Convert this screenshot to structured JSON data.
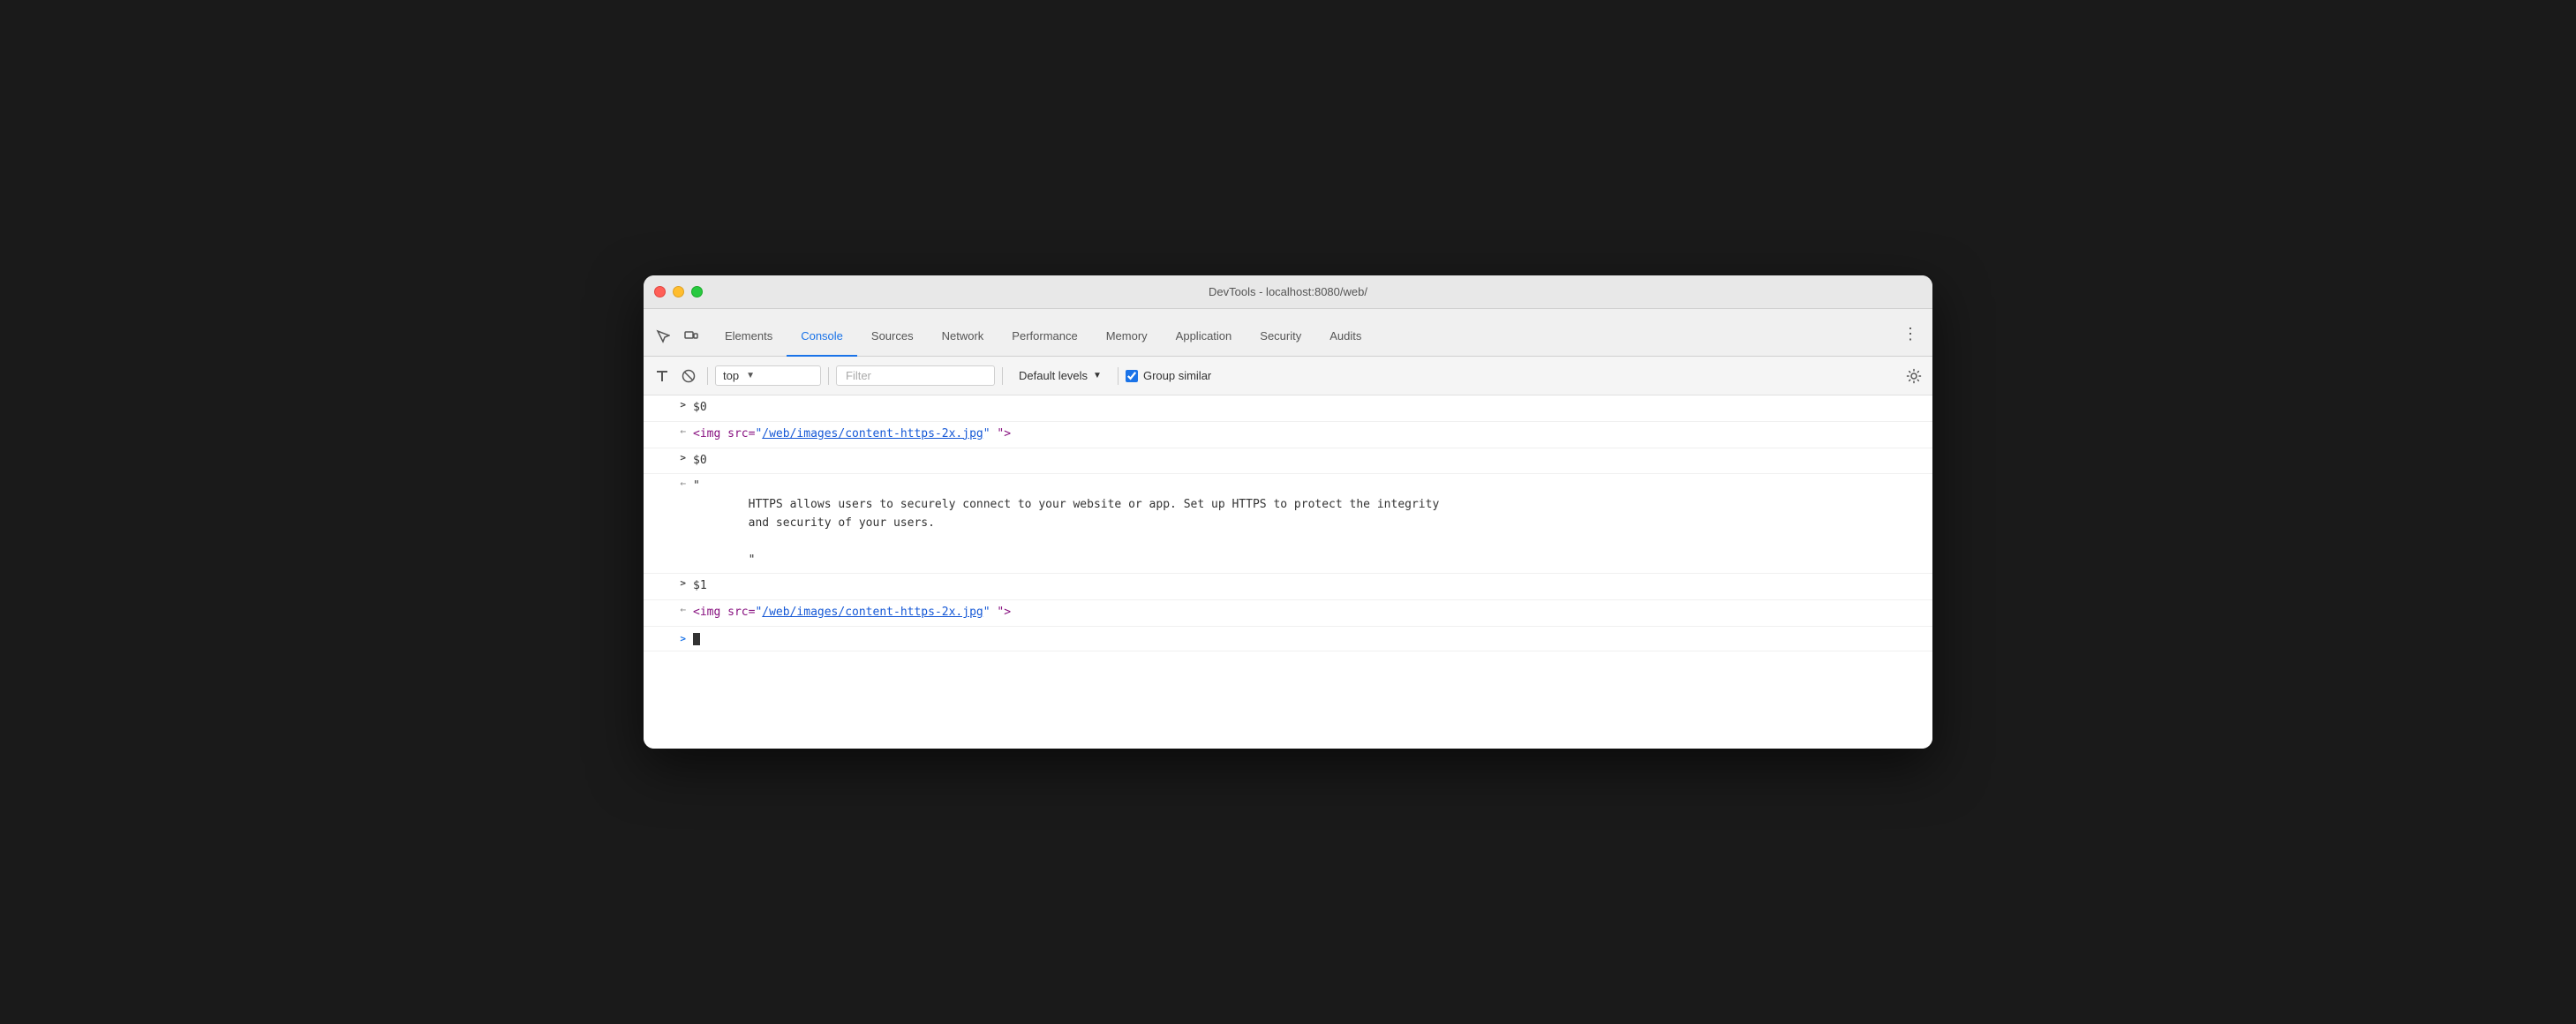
{
  "window": {
    "title": "DevTools - localhost:8080/web/",
    "traffic_lights": {
      "close": "close",
      "minimize": "minimize",
      "maximize": "maximize"
    }
  },
  "tabs": {
    "items": [
      {
        "id": "elements",
        "label": "Elements",
        "active": false
      },
      {
        "id": "console",
        "label": "Console",
        "active": true
      },
      {
        "id": "sources",
        "label": "Sources",
        "active": false
      },
      {
        "id": "network",
        "label": "Network",
        "active": false
      },
      {
        "id": "performance",
        "label": "Performance",
        "active": false
      },
      {
        "id": "memory",
        "label": "Memory",
        "active": false
      },
      {
        "id": "application",
        "label": "Application",
        "active": false
      },
      {
        "id": "security",
        "label": "Security",
        "active": false
      },
      {
        "id": "audits",
        "label": "Audits",
        "active": false
      }
    ]
  },
  "toolbar": {
    "context_label": "top",
    "filter_placeholder": "Filter",
    "levels_label": "Default levels",
    "group_similar_label": "Group similar",
    "group_similar_checked": true
  },
  "console": {
    "rows": [
      {
        "type": "prompt",
        "prompt": ">",
        "content": "$0"
      },
      {
        "type": "return",
        "content_prefix": "<img src=\"",
        "link": "/web/images/content-https-2x.jpg",
        "content_suffix": "\" \">"
      },
      {
        "type": "prompt",
        "prompt": ">",
        "content": "$0"
      },
      {
        "type": "return_multiline",
        "lines": [
          "\"",
          "        HTTPS allows users to securely connect to your website or app. Set up HTTPS to protect the integrity",
          "        and security of your users.",
          "",
          "        \""
        ]
      },
      {
        "type": "prompt",
        "prompt": ">",
        "content": "$1"
      },
      {
        "type": "return",
        "content_prefix": "<img src=\"",
        "link": "/web/images/content-https-2x.jpg",
        "content_suffix": "\" \">"
      }
    ],
    "input_prompt": ">",
    "input_cursor": true
  }
}
